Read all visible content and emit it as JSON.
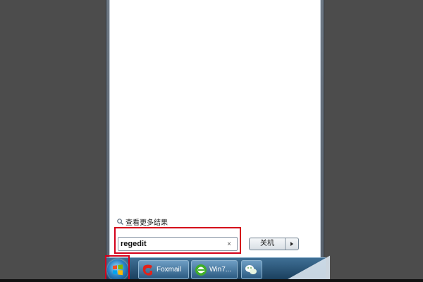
{
  "start_menu": {
    "see_more_label": "查看更多结果",
    "search": {
      "value": "regedit",
      "clear_glyph": "×"
    },
    "shutdown_label": "关机"
  },
  "taskbar": {
    "items": [
      {
        "label": "Foxmail",
        "icon": "foxmail-icon"
      },
      {
        "label": "Win7...",
        "icon": "ie-icon"
      },
      {
        "label": "",
        "icon": "wechat-icon"
      }
    ]
  },
  "colors": {
    "highlight": "#d4001a",
    "taskbar": "#2b5a81",
    "background": "#4c4c4c"
  }
}
